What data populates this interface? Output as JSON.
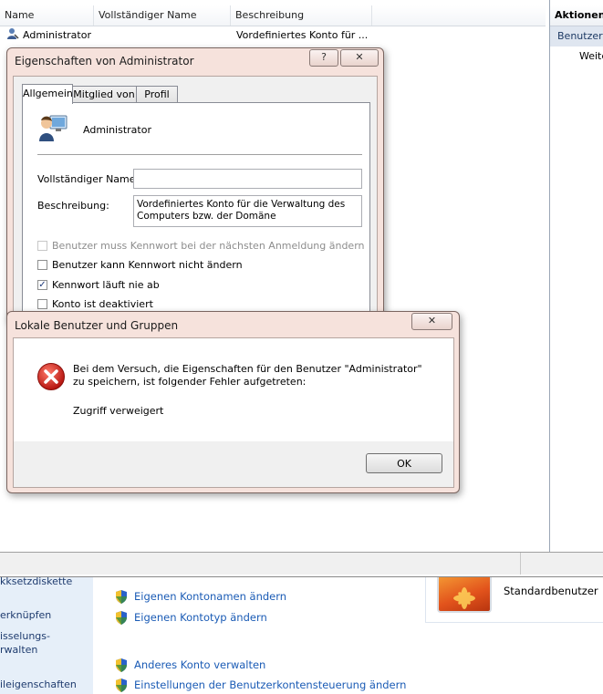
{
  "mmc": {
    "columns": [
      "Name",
      "Vollständiger Name",
      "Beschreibung"
    ],
    "row": {
      "name": "Administrator",
      "description": "Vordefiniertes Konto für ..."
    },
    "actions_header": "Aktionen",
    "actions_selected": "Benutzer",
    "actions_item": "Weite"
  },
  "properties_dialog": {
    "title": "Eigenschaften von Administrator",
    "help_button": "?",
    "close_button": "✕",
    "tabs": [
      "Allgemein",
      "Mitglied von",
      "Profil"
    ],
    "active_tab": "Allgemein",
    "user_name": "Administrator",
    "full_name_label": "Vollständiger Name:",
    "full_name_value": "",
    "description_label": "Beschreibung:",
    "description_value": "Vordefiniertes Konto für die Verwaltung des Computers bzw. der Domäne",
    "checkboxes": [
      {
        "label": "Benutzer muss Kennwort bei der nächsten Anmeldung ändern",
        "checked": false,
        "disabled": true
      },
      {
        "label": "Benutzer kann Kennwort nicht ändern",
        "checked": false,
        "disabled": false
      },
      {
        "label": "Kennwort läuft nie ab",
        "checked": true,
        "disabled": false
      },
      {
        "label": "Konto ist deaktiviert",
        "checked": false,
        "disabled": false
      }
    ]
  },
  "error_dialog": {
    "title": "Lokale Benutzer und Gruppen",
    "close_button": "✕",
    "message": "Bei dem Versuch, die Eigenschaften für den Benutzer \"Administrator\" zu speichern, ist folgender Fehler aufgetreten:",
    "detail": "Zugriff verweigert",
    "ok_button": "OK"
  },
  "control_panel": {
    "left_items": [
      "kksetzdiskette",
      "erknüpfen",
      "isselungs-",
      "rwalten",
      "ileigenschaften"
    ],
    "links": [
      "Eigenen Kontonamen ändern",
      "Eigenen Kontotyp ändern",
      "Anderes Konto verwalten",
      "Einstellungen der Benutzerkontensteuerung ändern"
    ],
    "account_type": "Standardbenutzer"
  },
  "colors": {
    "link": "#1a5bb5",
    "dialog_frame": "#f6e2dc",
    "error_red": "#cc1f1f"
  }
}
